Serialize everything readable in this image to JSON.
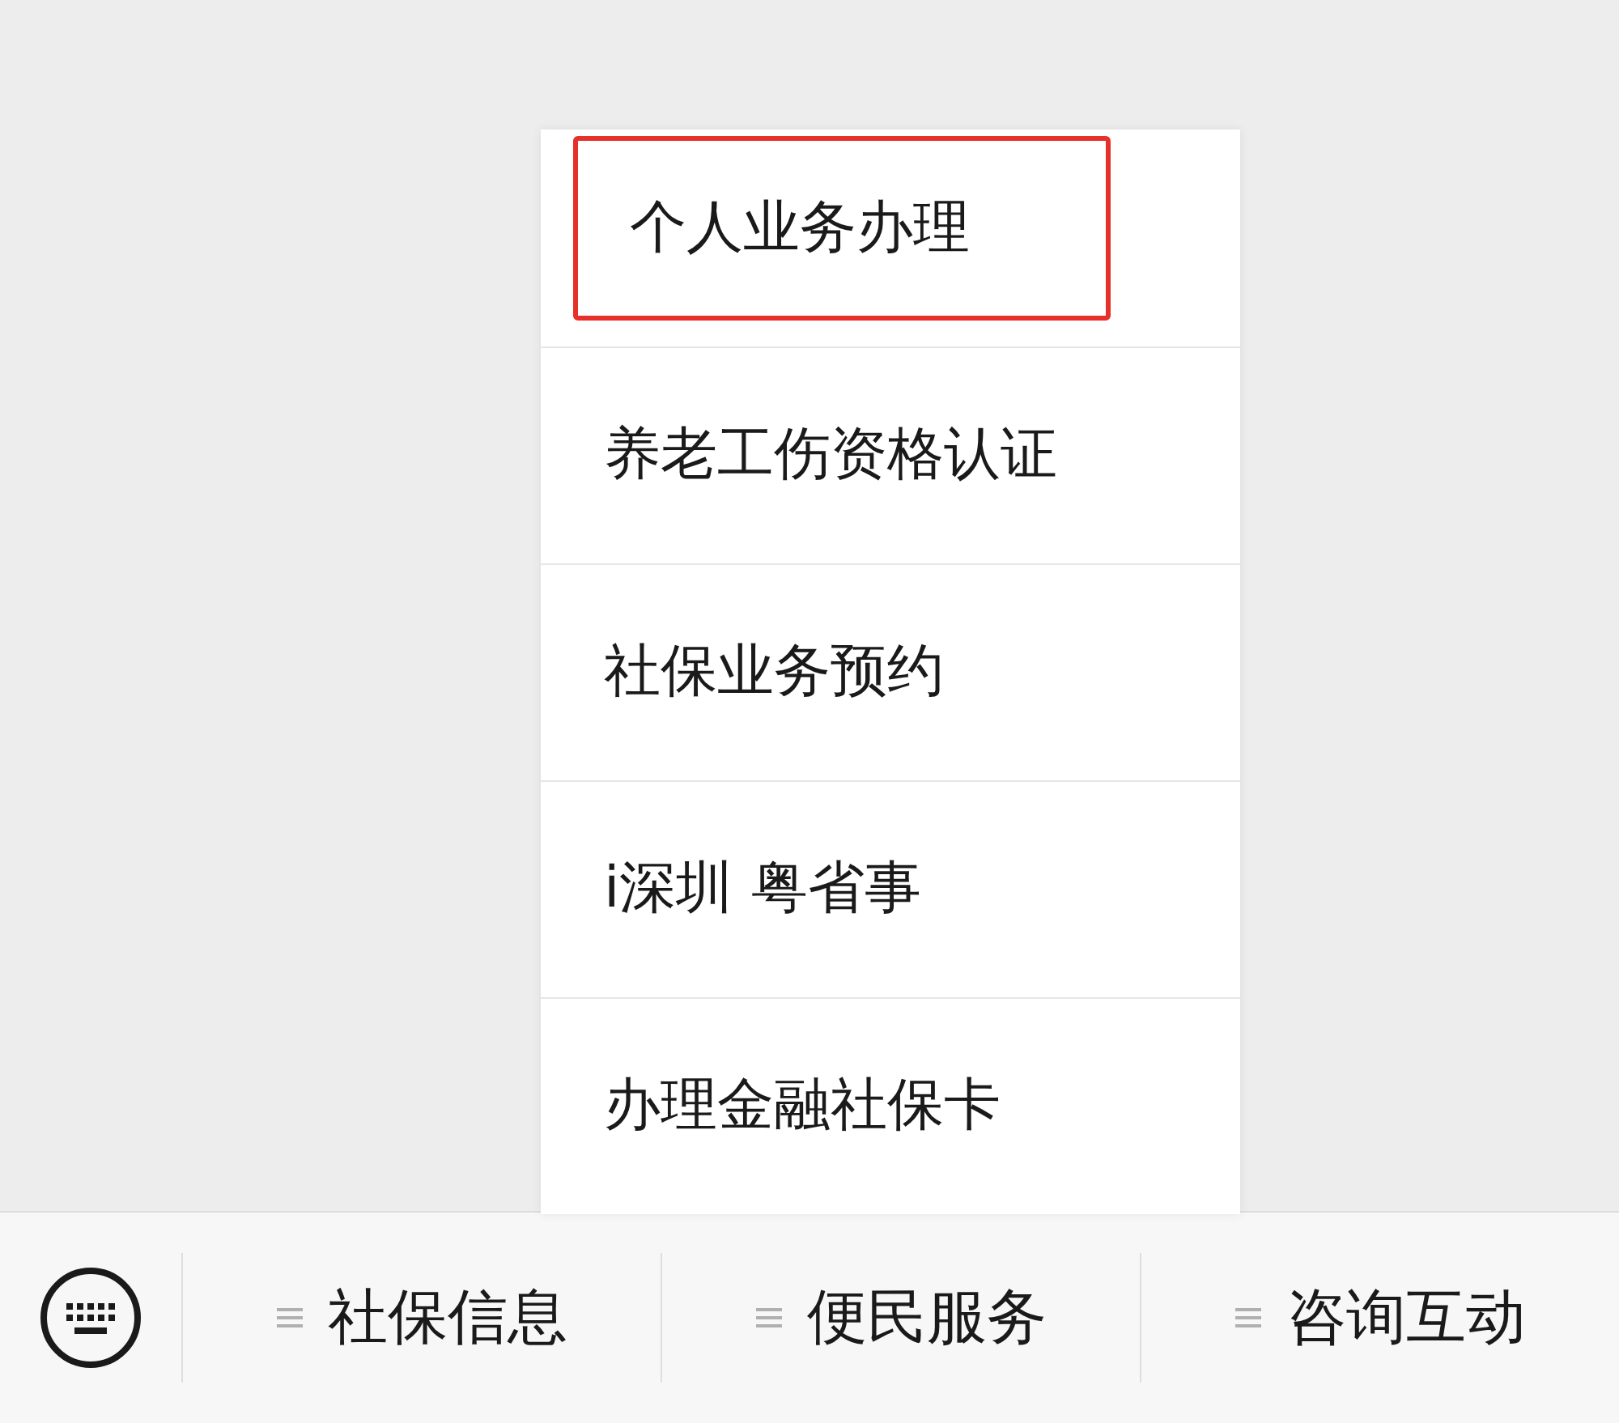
{
  "popup_menu": {
    "items": [
      {
        "label": "个人业务办理",
        "highlighted": true
      },
      {
        "label": "养老工伤资格认证",
        "highlighted": false
      },
      {
        "label": "社保业务预约",
        "highlighted": false
      },
      {
        "label": "i深圳 粤省事",
        "highlighted": false
      },
      {
        "label": "办理金融社保卡",
        "highlighted": false
      }
    ]
  },
  "bottom_menu": {
    "tabs": [
      {
        "label": "社保信息"
      },
      {
        "label": "便民服务"
      },
      {
        "label": "咨询互动"
      }
    ]
  }
}
